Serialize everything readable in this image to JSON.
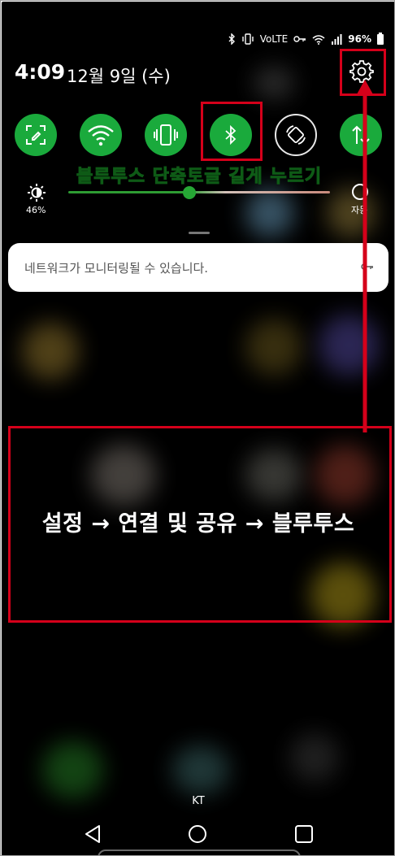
{
  "status_bar": {
    "network": "VoLTE",
    "battery": "96%",
    "icons": [
      "bluetooth-icon",
      "vibrate-icon",
      "volte-icon",
      "key-icon",
      "wifi-icon",
      "signal-icon",
      "battery-icon"
    ]
  },
  "header": {
    "time": "4:09",
    "date": "12월 9일 (수)"
  },
  "quick_tiles": [
    {
      "icon": "screenshot-icon",
      "state": "on"
    },
    {
      "icon": "wifi-icon",
      "state": "on"
    },
    {
      "icon": "vibrate-icon",
      "state": "on"
    },
    {
      "icon": "bluetooth-icon",
      "state": "on"
    },
    {
      "icon": "auto-rotate-icon",
      "state": "off"
    },
    {
      "icon": "data-icon",
      "state": "on"
    }
  ],
  "brightness": {
    "percent_label": "46%",
    "level": 0.46,
    "auto_label": "자동"
  },
  "annotation_bluetooth": "블루투스 단축토글 길게 누르기",
  "notification": {
    "text": "네트워크가 모니터링될 수 있습니다."
  },
  "annotation_main": "설정 → 연결 및 공유 → 블루투스",
  "carrier": "KT",
  "colors": {
    "accent_green": "#1aaa3c",
    "highlight_red": "#d5001a",
    "annotation_green": "#2fd43f"
  }
}
